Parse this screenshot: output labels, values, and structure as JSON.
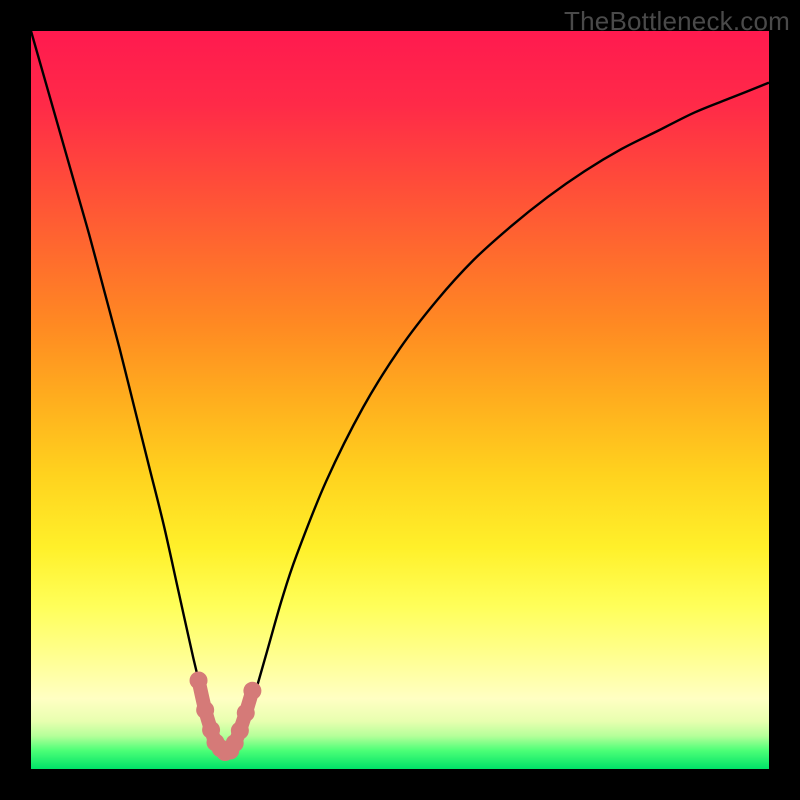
{
  "watermark": "TheBottleneck.com",
  "colors": {
    "bg": "#000000",
    "curve": "#000000",
    "marker_fill": "#d57a78",
    "marker_stroke": "#d57a78",
    "gradient_stops": [
      {
        "offset": 0.0,
        "color": "#ff1a4f"
      },
      {
        "offset": 0.1,
        "color": "#ff2a48"
      },
      {
        "offset": 0.2,
        "color": "#ff4a3a"
      },
      {
        "offset": 0.3,
        "color": "#ff6a2e"
      },
      {
        "offset": 0.4,
        "color": "#ff8a22"
      },
      {
        "offset": 0.5,
        "color": "#ffae1e"
      },
      {
        "offset": 0.6,
        "color": "#ffd21e"
      },
      {
        "offset": 0.7,
        "color": "#fff02a"
      },
      {
        "offset": 0.78,
        "color": "#ffff5a"
      },
      {
        "offset": 0.84,
        "color": "#ffff8a"
      },
      {
        "offset": 0.905,
        "color": "#ffffc3"
      },
      {
        "offset": 0.935,
        "color": "#e8ffb0"
      },
      {
        "offset": 0.955,
        "color": "#b6ff9a"
      },
      {
        "offset": 0.975,
        "color": "#4cff77"
      },
      {
        "offset": 1.0,
        "color": "#00e268"
      }
    ]
  },
  "chart_data": {
    "type": "line",
    "title": "",
    "xlabel": "",
    "ylabel": "",
    "xlim": [
      0,
      100
    ],
    "ylim": [
      0,
      100
    ],
    "series": [
      {
        "name": "bottleneck-curve",
        "x": [
          0,
          2,
          4,
          6,
          8,
          10,
          12,
          14,
          16,
          18,
          20,
          22,
          23,
          24,
          25,
          26,
          27,
          28,
          29,
          30,
          32,
          34,
          36,
          40,
          45,
          50,
          55,
          60,
          65,
          70,
          75,
          80,
          85,
          90,
          95,
          100
        ],
        "y": [
          100,
          93,
          86,
          79,
          72,
          64.5,
          57,
          49,
          41,
          33,
          24,
          15,
          11,
          7.5,
          4.5,
          2.8,
          2.2,
          3.1,
          5.6,
          9,
          16,
          23,
          29,
          39,
          49,
          57,
          63.5,
          69,
          73.5,
          77.5,
          81,
          84,
          86.5,
          89,
          91,
          93
        ]
      }
    ],
    "markers": {
      "name": "highlight-bottom",
      "x": [
        22.7,
        23.6,
        24.4,
        25.0,
        25.7,
        26.3,
        27.0,
        27.6,
        28.3,
        29.1,
        30.0
      ],
      "y": [
        12.0,
        8.0,
        5.3,
        3.6,
        2.8,
        2.3,
        2.5,
        3.5,
        5.2,
        7.6,
        10.6
      ]
    }
  }
}
